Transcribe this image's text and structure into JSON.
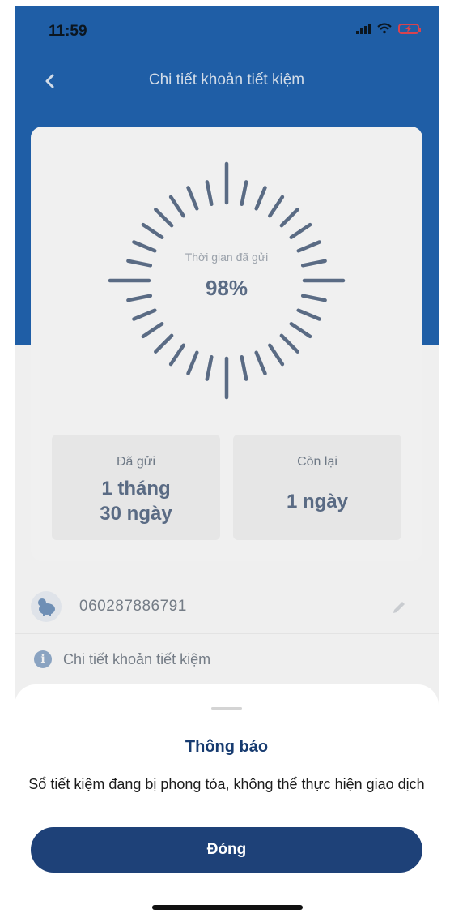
{
  "status_bar": {
    "time": "11:59",
    "signal_icon": "signal-icon",
    "wifi_icon": "wifi-icon",
    "battery_icon": "battery-charging-icon"
  },
  "header": {
    "title": "Chi tiết khoản tiết kiệm",
    "back_icon": "chevron-left-icon"
  },
  "progress": {
    "label": "Thời gian đã gửi",
    "value_text": "98%",
    "percent": 98
  },
  "stats": {
    "deposited": {
      "label": "Đã gửi",
      "value_line1": "1 tháng",
      "value_line2": "30 ngày"
    },
    "remaining": {
      "label": "Còn lại",
      "value": "1 ngày"
    }
  },
  "account": {
    "number": "060287886791",
    "icon": "piggy-bank-icon",
    "edit_icon": "pencil-icon"
  },
  "info_row": {
    "label": "Chi tiết khoản tiết kiệm",
    "icon": "info-icon"
  },
  "dialog": {
    "title": "Thông báo",
    "message": "Sổ tiết kiệm đang bị phong tỏa, không thể thực hiện giao dịch",
    "button_label": "Đóng"
  },
  "colors": {
    "header_blue": "#1f5ea6",
    "button_navy": "#1e4178",
    "title_navy": "#173b70",
    "ring_tick": "#5a6b84"
  }
}
